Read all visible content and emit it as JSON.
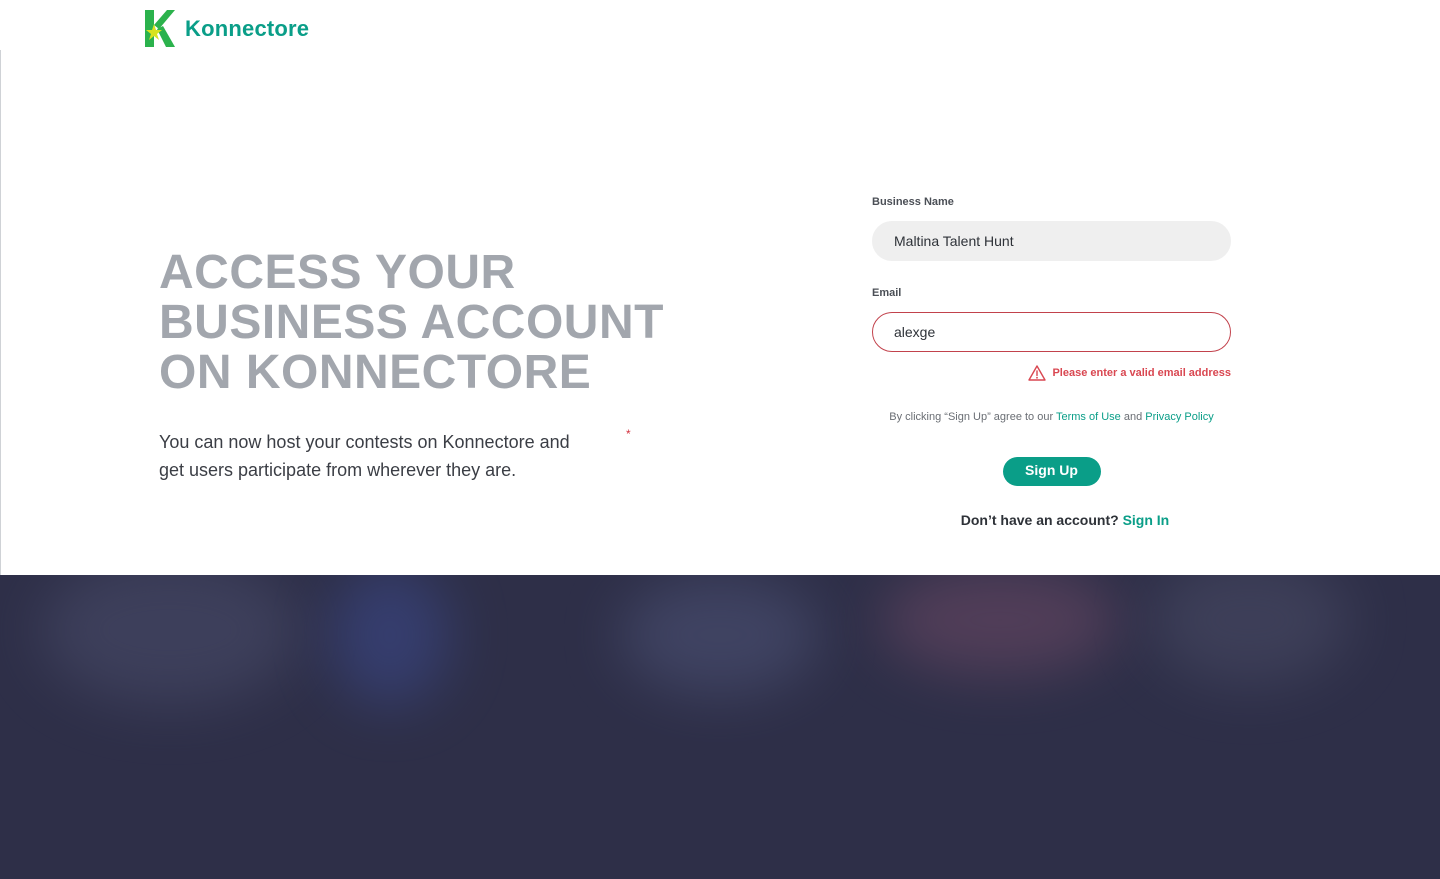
{
  "brand": {
    "name": "Konnectore",
    "logo_letter": "K",
    "colors": {
      "primary": "#0a9e88",
      "logo_green": "#2bb24c",
      "logo_yellow": "#d8e21f",
      "error": "#d94751",
      "heading_gray": "#a2a6ad",
      "footer_bg": "#2e2f48"
    }
  },
  "hero": {
    "title_line1": "ACCESS YOUR",
    "title_line2": "BUSINESS ACCOUNT",
    "title_line3": "ON KONNECTORE",
    "subtitle": "You can now host your contests on Konnectore and get users participate from wherever they are.",
    "stray_asterisk": "*"
  },
  "form": {
    "business_name": {
      "label": "Business Name",
      "value": "Maltina Talent Hunt"
    },
    "email": {
      "label": "Email",
      "value": "alexge",
      "error": "Please enter a valid email address",
      "error_icon": "warning-triangle-icon"
    },
    "terms": {
      "prefix": "By clicking “Sign Up”  agree to our",
      "terms_link": "Terms of Use",
      "conjunction": "and",
      "privacy_link": "Privacy Policy"
    },
    "submit_label": "Sign Up",
    "account_prompt": "Don’t have an account?",
    "signin_link": "Sign In"
  }
}
